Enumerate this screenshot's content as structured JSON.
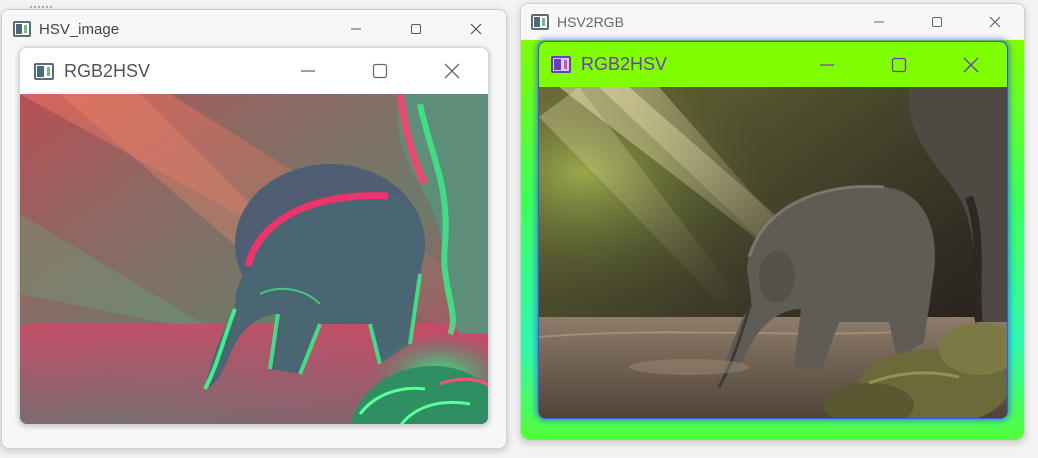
{
  "windows": {
    "hsv_image": {
      "title": "HSV_image"
    },
    "rgb2hsv_left": {
      "title": "RGB2HSV"
    },
    "hsv2rgb": {
      "title": "HSV2RGB"
    },
    "rgb2hsv_right": {
      "title": "RGB2HSV"
    }
  },
  "controls": {
    "minimize": "minimize-icon",
    "maximize": "maximize-icon",
    "close": "close-icon"
  },
  "colors": {
    "inner_titlebar_lime": "#7fff00",
    "title_purple": "#6a3fb5",
    "glow_green": "#39ff4a"
  }
}
